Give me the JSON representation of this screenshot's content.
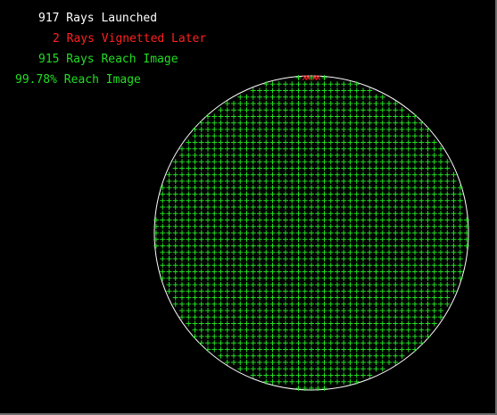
{
  "stats": {
    "launched": "917 Rays Launched",
    "vignetted": "2 Rays Vignetted Later",
    "reach_image": "915 Rays Reach Image",
    "percent_reach": "99.78% Reach Image"
  },
  "colors": {
    "background": "#000000",
    "launched": "#ffffff",
    "vignetted": "#ff2020",
    "reached": "#22dd22",
    "aperture": "#ffffff"
  },
  "footprint": {
    "ray_counts": {
      "launched": 917,
      "vignetted": 2,
      "reached": 915
    },
    "vignetted_marker": "x",
    "reached_marker": "+"
  }
}
